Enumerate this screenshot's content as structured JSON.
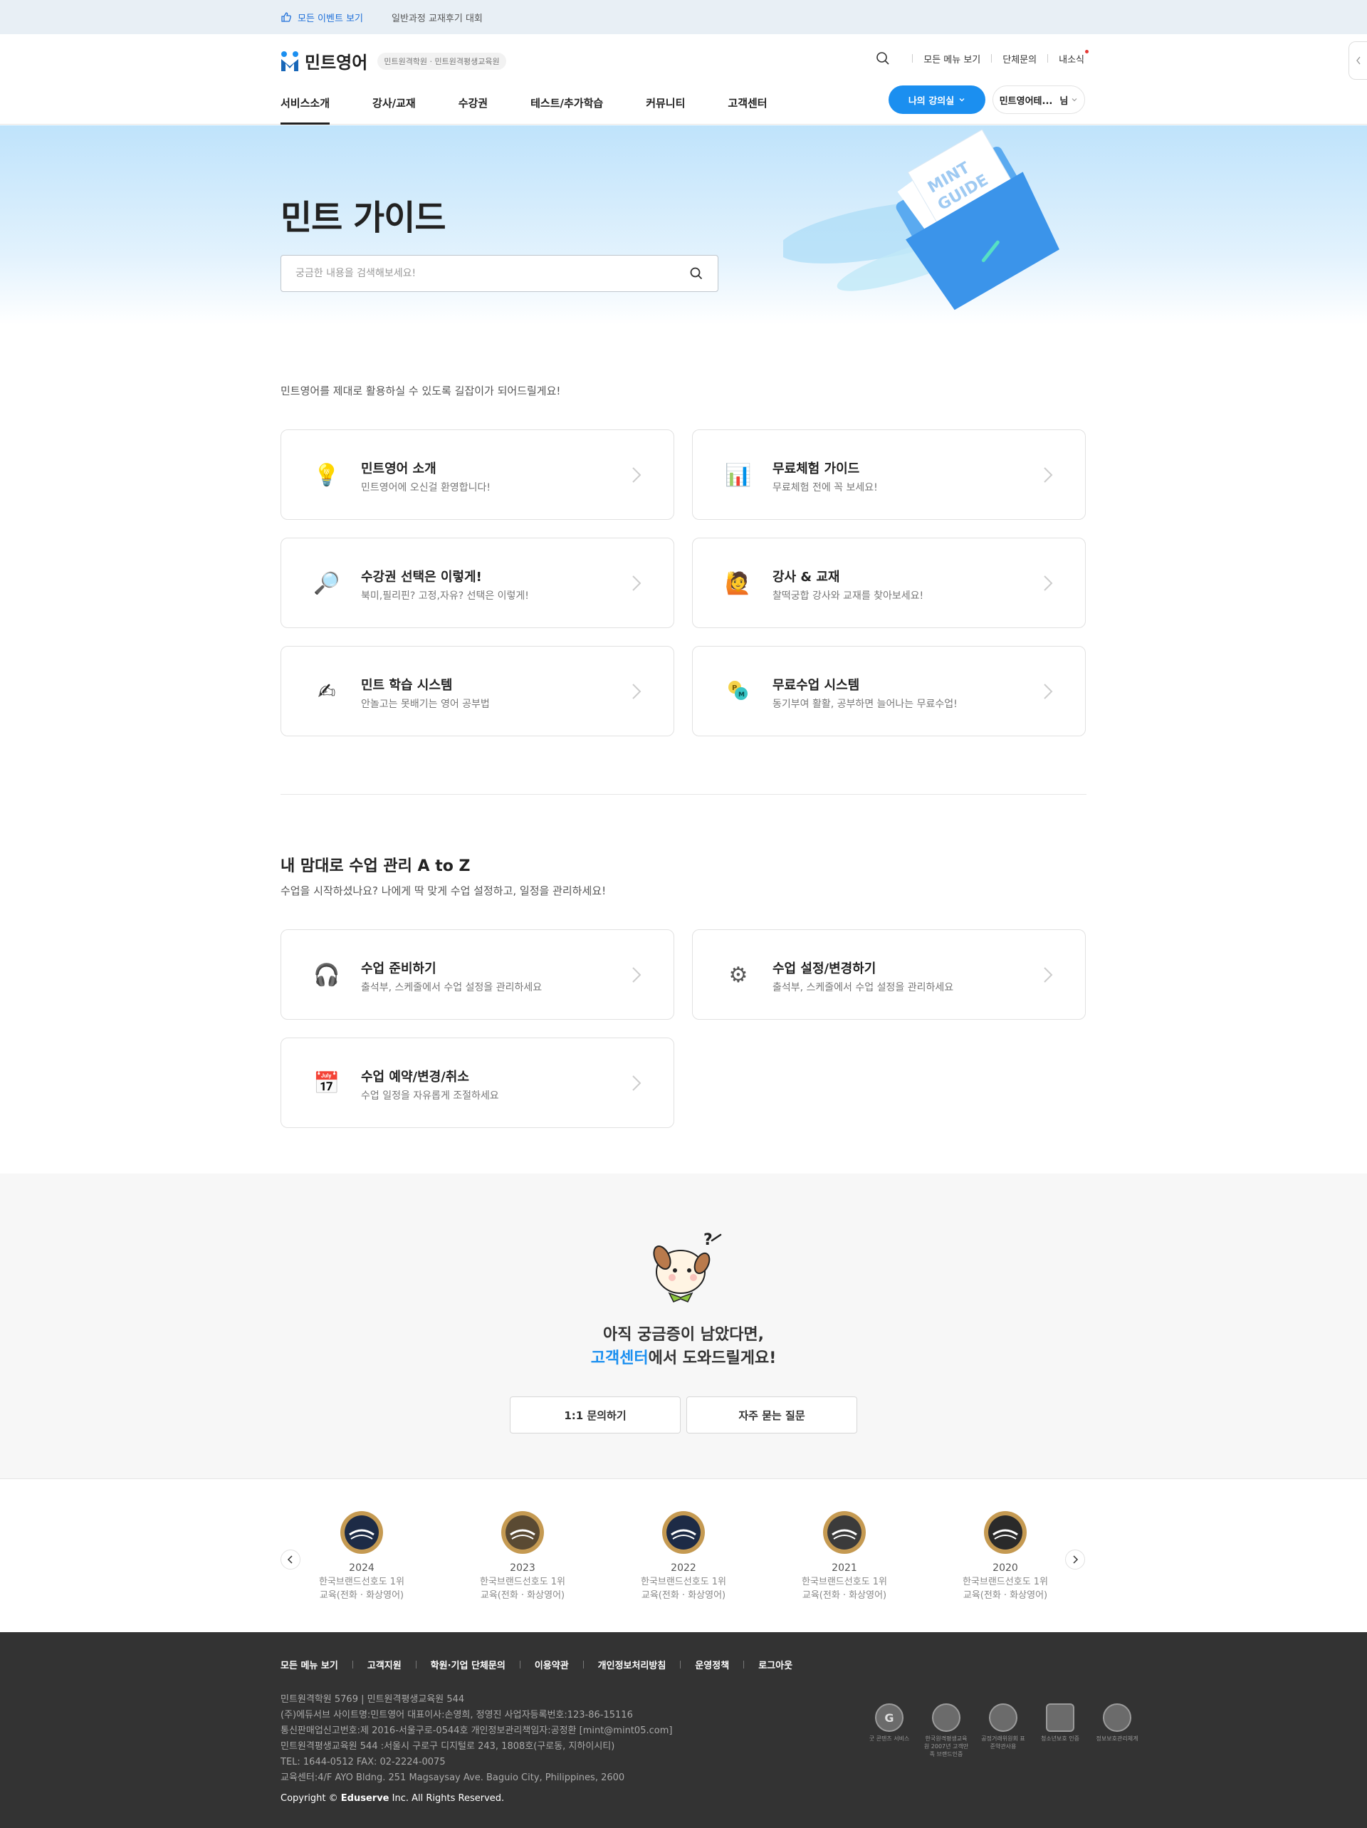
{
  "topbar": {
    "events_link": "모든 이벤트 보기",
    "review_link": "일반과정 교재후기 대회"
  },
  "header": {
    "logo_text": "민트영어",
    "logo_tagline": "민트원격학원 · 민트원격평생교육원",
    "util": {
      "all_menu": "모든 메뉴 보기",
      "group_inquiry": "단체문의",
      "news": "내소식"
    },
    "nav": [
      "서비스소개",
      "강사/교재",
      "수강권",
      "테스트/추가학습",
      "커뮤니티",
      "고객센터"
    ],
    "my_classroom": "나의 강의실",
    "user_name": "민트영어테...",
    "user_suffix": "님"
  },
  "hero": {
    "title": "민트 가이드",
    "search_placeholder": "궁금한 내용을 검색해보세요!",
    "folder_label_1": "MINT",
    "folder_label_2": "GUIDE"
  },
  "guide": {
    "intro": "민트영어를 제대로 활용하실 수 있도록 길잡이가 되어드릴게요!",
    "cards": [
      {
        "icon": "lightbulb-icon",
        "emoji": "💡",
        "title": "민트영어 소개",
        "desc": "민트영어에 오신걸 환영합니다!"
      },
      {
        "icon": "bar-chart-icon",
        "emoji": "📊",
        "title": "무료체험 가이드",
        "desc": "무료체험 전에 꼭 보세요!"
      },
      {
        "icon": "magnifier-icon",
        "emoji": "🔎",
        "title": "수강권 선택은 이렇게!",
        "desc": "북미,필리핀? 고정,자유? 선택은 이렇게!"
      },
      {
        "icon": "person-raising-hand-icon",
        "emoji": "🙋",
        "title": "강사 & 교재",
        "desc": "찰떡궁합 강사와 교재를 찾아보세요!"
      },
      {
        "icon": "writing-hand-icon",
        "emoji": "✍",
        "title": "민트 학습 시스템",
        "desc": "안놀고는 못배기는 영어 공부법"
      },
      {
        "icon": "coin-points-icon",
        "emoji": "🪙",
        "title": "무료수업 시스템",
        "desc": "동기부여 활활, 공부하면 늘어나는 무료수업!"
      }
    ]
  },
  "manage": {
    "title": "내 맘대로 수업 관리 A to Z",
    "subtitle": "수업을 시작하셨나요? 나에게 딱 맞게 수업 설정하고, 일정을 관리하세요!",
    "cards": [
      {
        "icon": "headphones-icon",
        "emoji": "🎧",
        "title": "수업 준비하기",
        "desc": "출석부, 스케줄에서 수업 설정을 관리하세요"
      },
      {
        "icon": "gear-icon",
        "emoji": "⚙",
        "title": "수업 설정/변경하기",
        "desc": "출석부, 스케줄에서 수업 설정을 관리하세요"
      },
      {
        "icon": "calendar-icon",
        "emoji": "📅",
        "title": "수업 예약/변경/취소",
        "desc": "수업 일정을 자유롭게 조절하세요"
      }
    ]
  },
  "help": {
    "line1": "아직 궁금증이 남았다면,",
    "line2_accent": "고객센터",
    "line2_rest": "에서 도와드릴게요!",
    "btn_inquiry": "1:1 문의하기",
    "btn_faq": "자주 묻는 질문"
  },
  "awards": [
    {
      "year": "2024",
      "line1": "한국브랜드선호도 1위",
      "line2": "교육(전화 · 화상영어)"
    },
    {
      "year": "2023",
      "line1": "한국브랜드선호도 1위",
      "line2": "교육(전화 · 화상영어)"
    },
    {
      "year": "2022",
      "line1": "한국브랜드선호도 1위",
      "line2": "교육(전화 · 화상영어)"
    },
    {
      "year": "2021",
      "line1": "한국브랜드선호도 1위",
      "line2": "교육(전화 · 화상영어)"
    },
    {
      "year": "2020",
      "line1": "한국브랜드선호도 1위",
      "line2": "교육(전화 · 화상영어)"
    }
  ],
  "footer": {
    "links": [
      "모든 메뉴 보기",
      "고객지원",
      "학원·기업 단체문의",
      "이용약관",
      "개인정보처리방침",
      "운영정책",
      "로그아웃"
    ],
    "info": [
      "민트원격학원 5769 | 민트원격평생교육원 544",
      "(주)에듀서브  사이트명:민트영어  대표이사:손영희, 정영진  사업자등록번호:123-86-15116",
      "통신판매업신고번호:제 2016-서울구로-0544호  개인정보관리책임자:공정환 [mint@mint05.com]",
      "민트원격평생교육원 544 :서울시 구로구 디지털로 243, 1808호(구로동, 지하이시티)",
      "TEL: 1644-0512 FAX: 02-2224-0075",
      "교육센터:4/F AYO Bldng. 251 Magsaysay Ave. Baguio City, Philippines, 2600"
    ],
    "copy_prefix": "Copyright ©",
    "copy_brand": "Eduserve",
    "copy_suffix": "Inc. All Rights Reserved.",
    "certs": [
      {
        "mark": "G",
        "text": "굿 콘텐츠 서비스"
      },
      {
        "mark": "",
        "text": "한국원격평생교육원 2007년 고객만족 브랜드인증"
      },
      {
        "mark": "",
        "text": "공정거래위원회 표준약관사용"
      },
      {
        "mark": "",
        "text": "청소년보호 인증"
      },
      {
        "mark": "",
        "text": "정보보호관리체계"
      }
    ]
  }
}
